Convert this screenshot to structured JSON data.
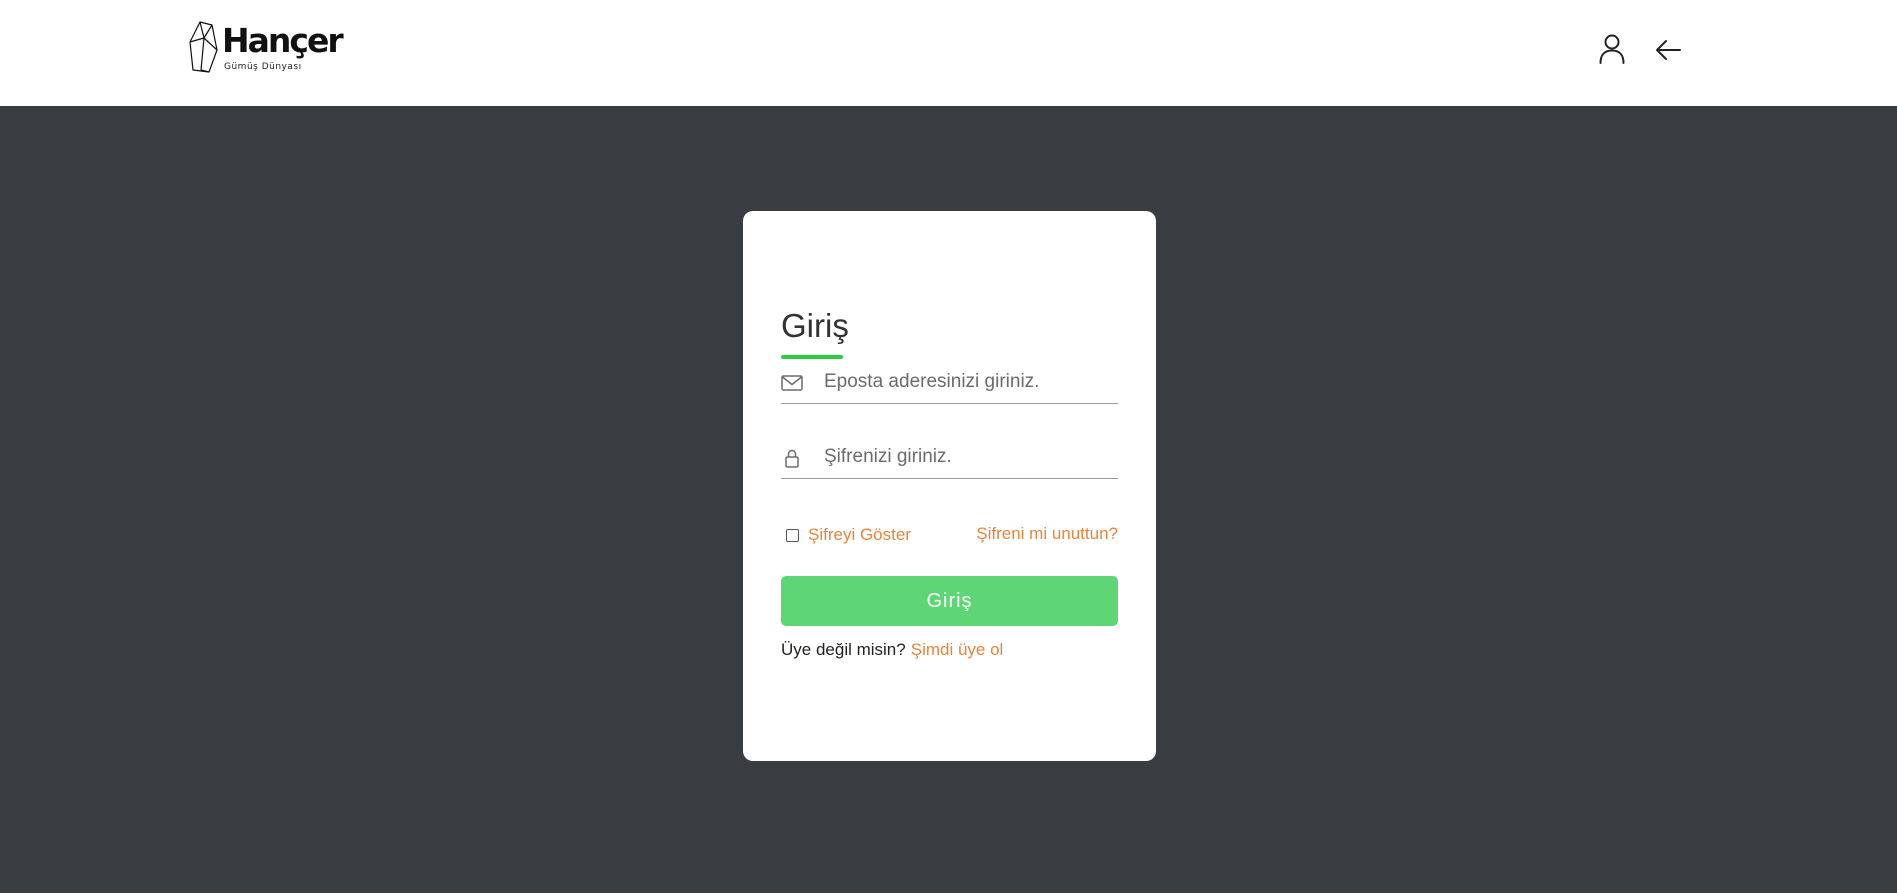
{
  "header": {
    "logo": {
      "name": "Hançer",
      "tagline": "Gümüş Dünyası"
    },
    "icons": {
      "account": "user-icon",
      "back": "arrow-left-icon"
    }
  },
  "login": {
    "title": "Giriş",
    "email": {
      "icon": "envelope-icon",
      "placeholder": "Eposta aderesinizi giriniz.",
      "value": ""
    },
    "password": {
      "icon": "lock-icon",
      "placeholder": "Şifrenizi giriniz.",
      "value": ""
    },
    "show_password": {
      "label": "Şifreyi Göster",
      "checked": false
    },
    "forgot_password": "Şifreni mi unuttun?",
    "submit_label": "Giriş",
    "register_prompt": "Üye değil misin?",
    "register_link": "Şimdi üye ol"
  },
  "colors": {
    "page_background": "#393d42",
    "accent_green": "#2ecc40",
    "button_green": "#5fd675",
    "link_orange": "#e8843a"
  }
}
